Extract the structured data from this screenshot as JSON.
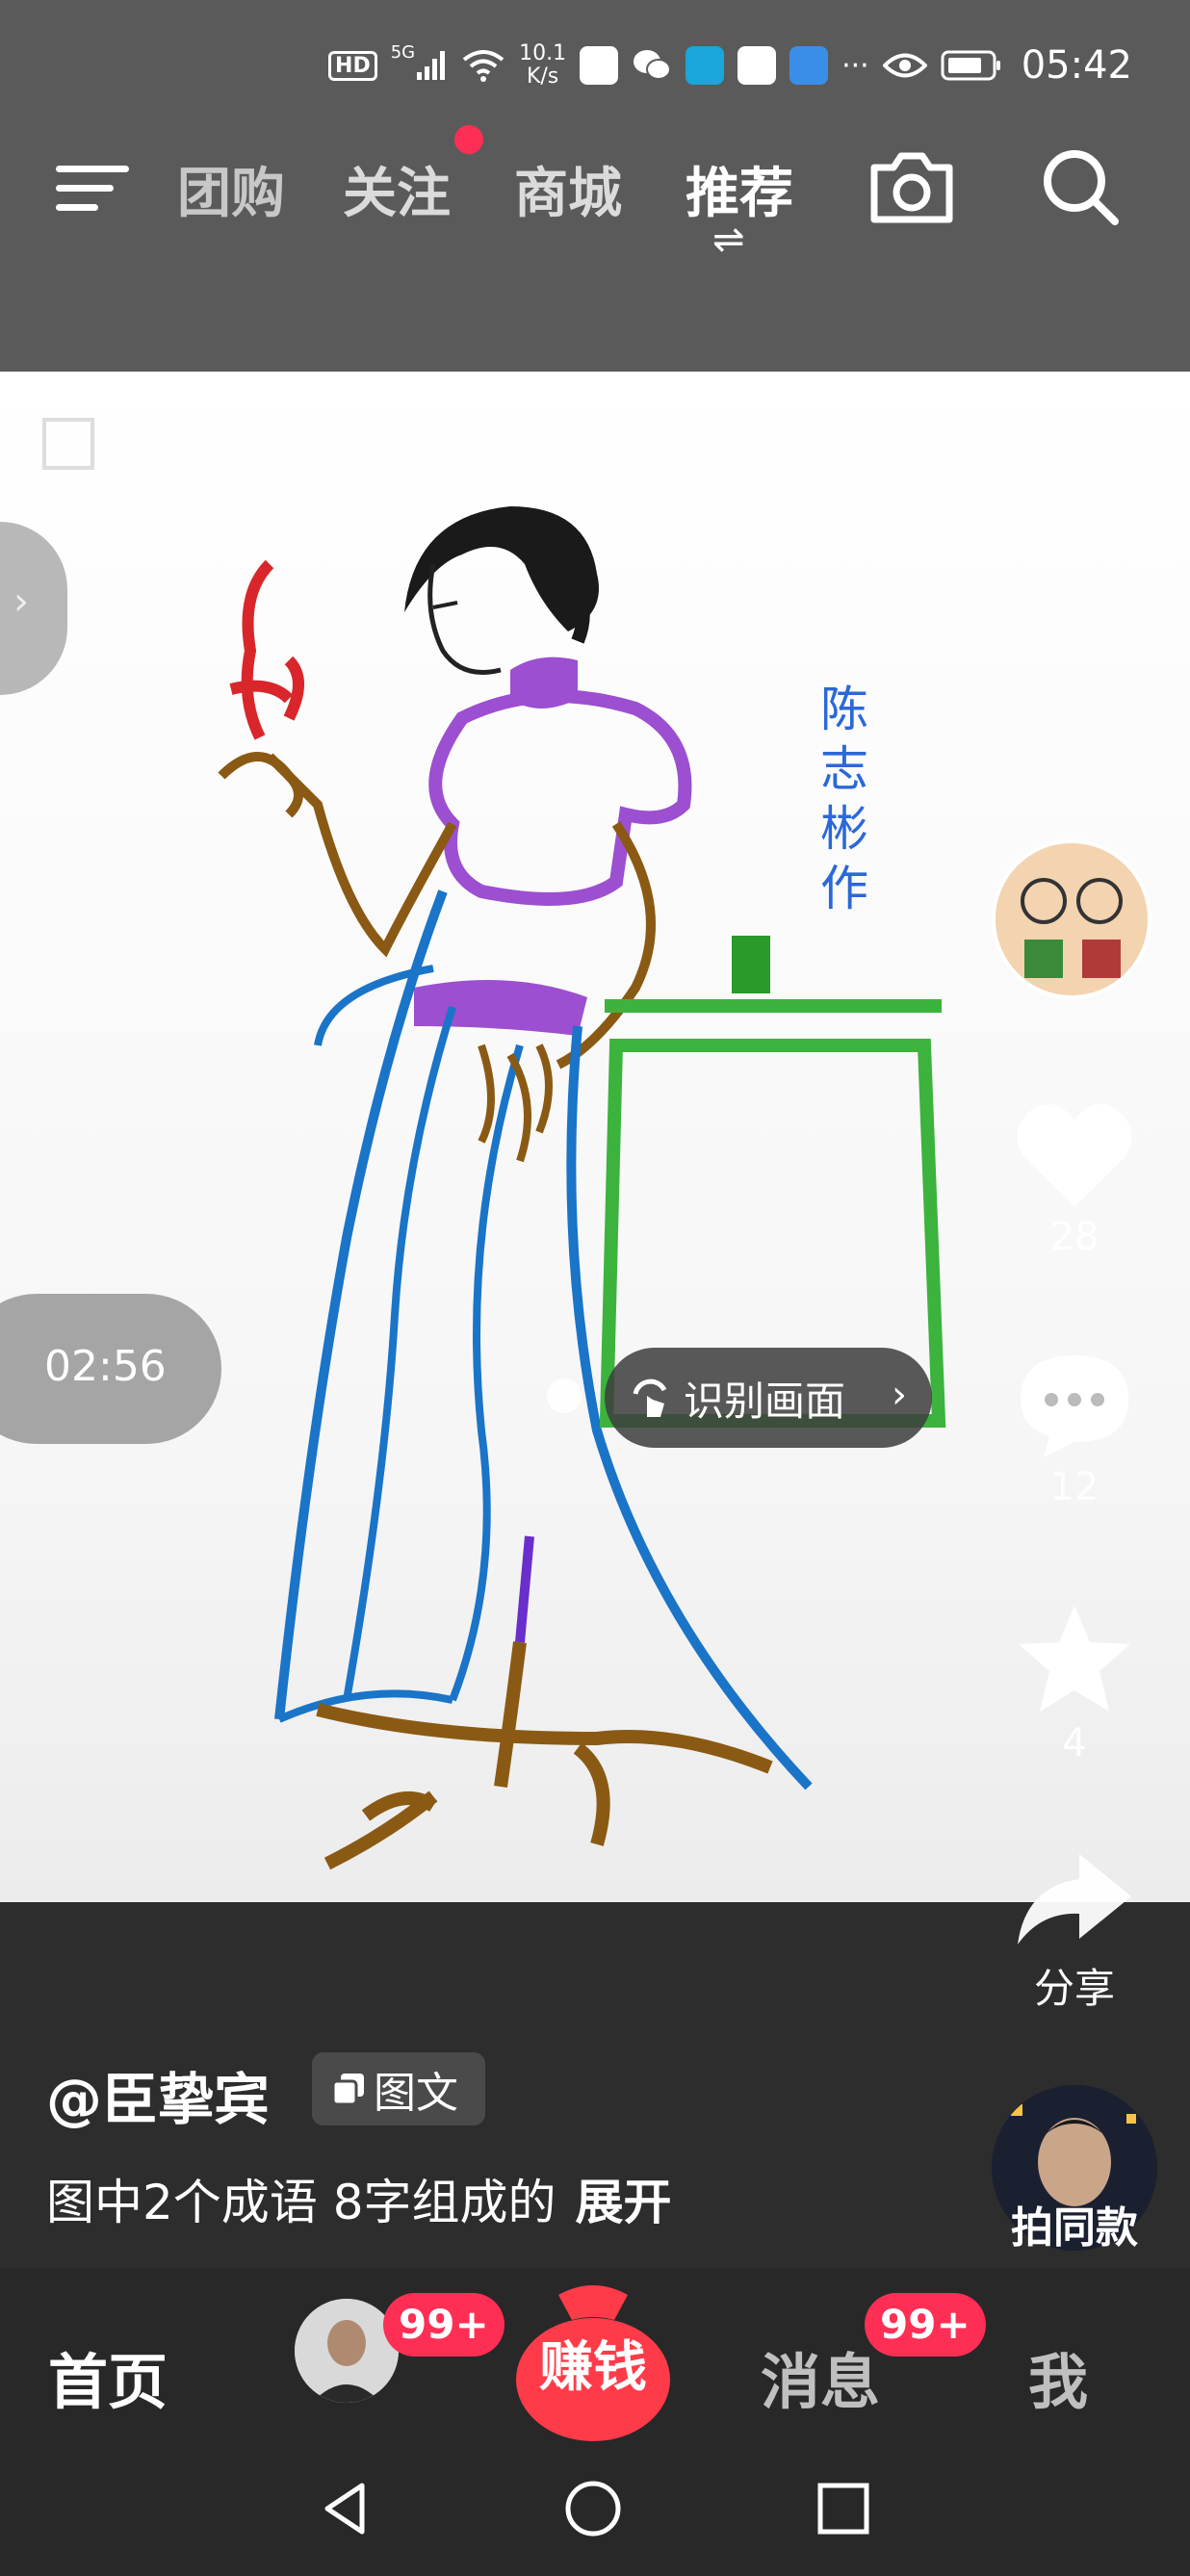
{
  "status_bar": {
    "hd": "HD",
    "signal": "5G",
    "net_speed_value": "10.1",
    "net_speed_unit": "K/s",
    "more": "···",
    "time": "05:42"
  },
  "nav": {
    "tabs": [
      "团购",
      "关注",
      "商城",
      "推荐"
    ],
    "active_tab": "推荐",
    "swap_glyph": "⇌"
  },
  "post": {
    "vertical_text": [
      "陈",
      "志",
      "彬",
      "作"
    ],
    "duration": "02:56",
    "recognize_label": "识别画面",
    "likes": "28",
    "comments": "12",
    "favorites": "4",
    "share_label": "分享",
    "username": "@臣挚宾",
    "tag_label": "图文",
    "description": "图中2个成语  8字组成的",
    "expand_label": "展开",
    "same_style_label": "拍同款"
  },
  "tabbar": {
    "home": "首页",
    "friends_badge": "99+",
    "earn": "赚钱",
    "messages": "消息",
    "messages_badge": "99+",
    "me": "我"
  },
  "colors": {
    "accent_red": "#ff2e55",
    "top_bg": "#5a5a5a",
    "bottom_bg": "#282828",
    "signature_blue": "#2b68d8"
  }
}
